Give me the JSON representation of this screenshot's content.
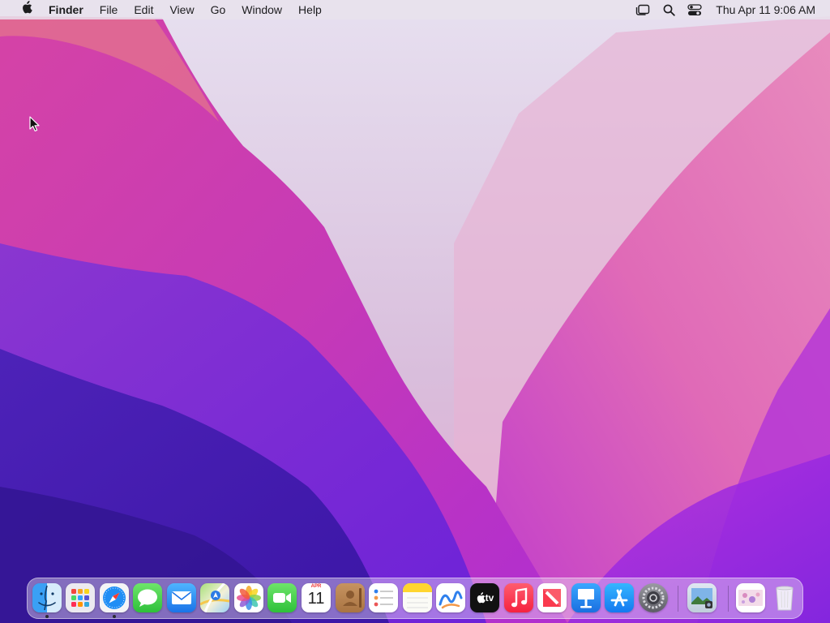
{
  "menubar": {
    "apple_icon": "apple-icon",
    "app_name": "Finder",
    "menus": [
      "File",
      "Edit",
      "View",
      "Go",
      "Window",
      "Help"
    ],
    "status_icons": [
      "stage-manager-icon",
      "search-icon",
      "control-center-icon"
    ],
    "clock": "Thu Apr 11  9:06 AM"
  },
  "desktop": {
    "wallpaper": "macOS Monterey",
    "colors": {
      "pink": "#d24aa8",
      "violet": "#7a2ad6",
      "indigo": "#3a1a9a",
      "haze": "#e9d8ea"
    }
  },
  "dock": {
    "items": [
      {
        "name": "Finder",
        "icon": "finder-icon",
        "running": true
      },
      {
        "name": "Launchpad",
        "icon": "launchpad-icon",
        "running": false
      },
      {
        "name": "Safari",
        "icon": "safari-icon",
        "running": true
      },
      {
        "name": "Messages",
        "icon": "messages-icon",
        "running": false
      },
      {
        "name": "Mail",
        "icon": "mail-icon",
        "running": false
      },
      {
        "name": "Maps",
        "icon": "maps-icon",
        "running": false
      },
      {
        "name": "Photos",
        "icon": "photos-icon",
        "running": false
      },
      {
        "name": "FaceTime",
        "icon": "facetime-icon",
        "running": false
      },
      {
        "name": "Calendar",
        "icon": "calendar-icon",
        "running": false,
        "month": "APR",
        "day": "11"
      },
      {
        "name": "Contacts",
        "icon": "contacts-icon",
        "running": false
      },
      {
        "name": "Reminders",
        "icon": "reminders-icon",
        "running": false
      },
      {
        "name": "Notes",
        "icon": "notes-icon",
        "running": false
      },
      {
        "name": "Freeform",
        "icon": "freeform-icon",
        "running": false
      },
      {
        "name": "TV",
        "icon": "tv-icon",
        "running": false,
        "label": "tv"
      },
      {
        "name": "Music",
        "icon": "music-icon",
        "running": false
      },
      {
        "name": "News",
        "icon": "news-icon",
        "running": false
      },
      {
        "name": "Keynote",
        "icon": "keynote-icon",
        "running": false
      },
      {
        "name": "App Store",
        "icon": "app-store-icon",
        "running": false
      },
      {
        "name": "System Settings",
        "icon": "system-settings-icon",
        "running": false
      },
      {
        "name": "Preview",
        "icon": "preview-icon",
        "running": false
      },
      {
        "name": "Downloads",
        "icon": "downloads-stack-icon",
        "running": false
      },
      {
        "name": "Trash",
        "icon": "trash-icon",
        "running": false
      }
    ]
  }
}
